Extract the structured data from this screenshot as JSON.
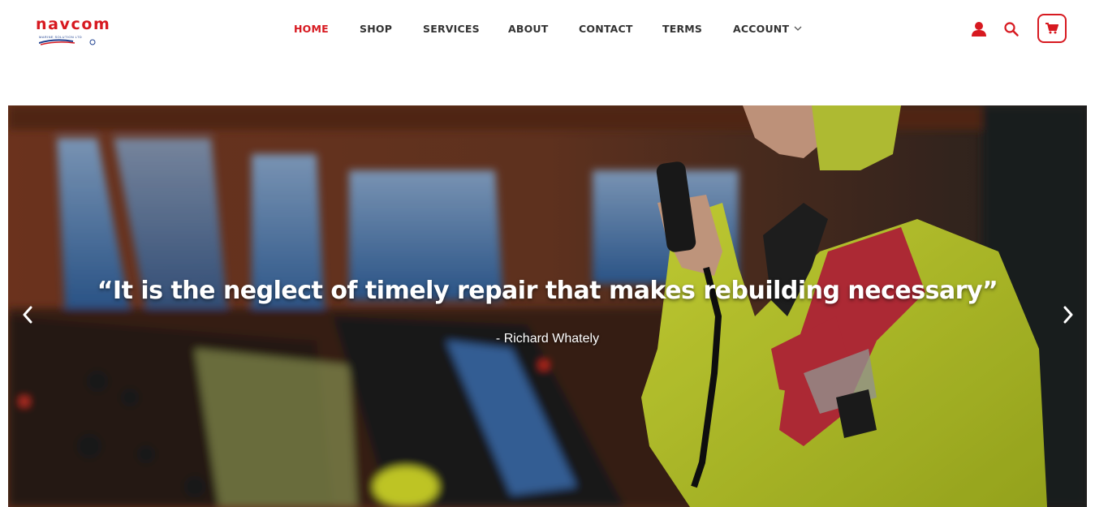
{
  "brand": {
    "name": "navcom",
    "tagline": "MARINE SOLUTION LTD"
  },
  "nav": {
    "items": [
      {
        "label": "HOME",
        "active": true
      },
      {
        "label": "SHOP"
      },
      {
        "label": "SERVICES"
      },
      {
        "label": "ABOUT"
      },
      {
        "label": "CONTACT"
      },
      {
        "label": "TERMS"
      },
      {
        "label": "ACCOUNT",
        "has_dropdown": true
      }
    ]
  },
  "header_icons": [
    "user-icon",
    "search-icon",
    "cart-icon"
  ],
  "hero": {
    "quote": "“It is the neglect of timely repair that makes rebuilding necessary”",
    "author": "- Richard Whately",
    "prev_icon": "chevron-left-icon",
    "next_icon": "chevron-right-icon"
  },
  "colors": {
    "accent": "#d71920",
    "nav_text": "#333333",
    "brand_blue": "#1d3f8f"
  }
}
